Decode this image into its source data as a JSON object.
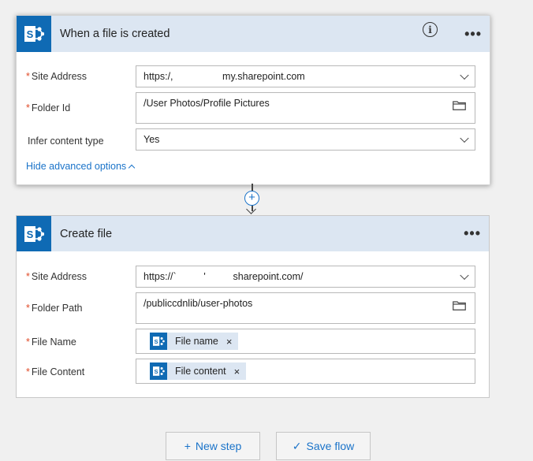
{
  "card1": {
    "title": "When a file is created",
    "more": "•••",
    "info": "i",
    "fields": [
      {
        "label": "Site Address",
        "required": "*",
        "value": "https:/,                  my.sharepoint.com"
      },
      {
        "label": "Folder Id",
        "required": "*",
        "value": "/User Photos/Profile Pictures"
      },
      {
        "label": "Infer content type",
        "required": "",
        "value": "Yes"
      }
    ],
    "advanced_link": "Hide advanced options"
  },
  "connector": {
    "plus": "+"
  },
  "card2": {
    "title": "Create file",
    "more": "•••",
    "fields": [
      {
        "label": "Site Address",
        "required": "*",
        "value": "https://`          '          sharepoint.com/"
      },
      {
        "label": "Folder Path",
        "required": "*",
        "value": "/publiccdnlib/user-photos"
      },
      {
        "label": "File Name",
        "required": "*",
        "token": "File name",
        "remove": "×"
      },
      {
        "label": "File Content",
        "required": "*",
        "token": "File content",
        "remove": "×"
      }
    ]
  },
  "actions": {
    "new_step_icon": "+",
    "new_step": "New step",
    "save_icon": "✓",
    "save_flow": "Save flow"
  },
  "colors": {
    "sharepoint_blue": "#0f6ab4",
    "header_bg": "#dce6f2",
    "link_blue": "#1a73c9",
    "required_red": "#e04b28"
  }
}
